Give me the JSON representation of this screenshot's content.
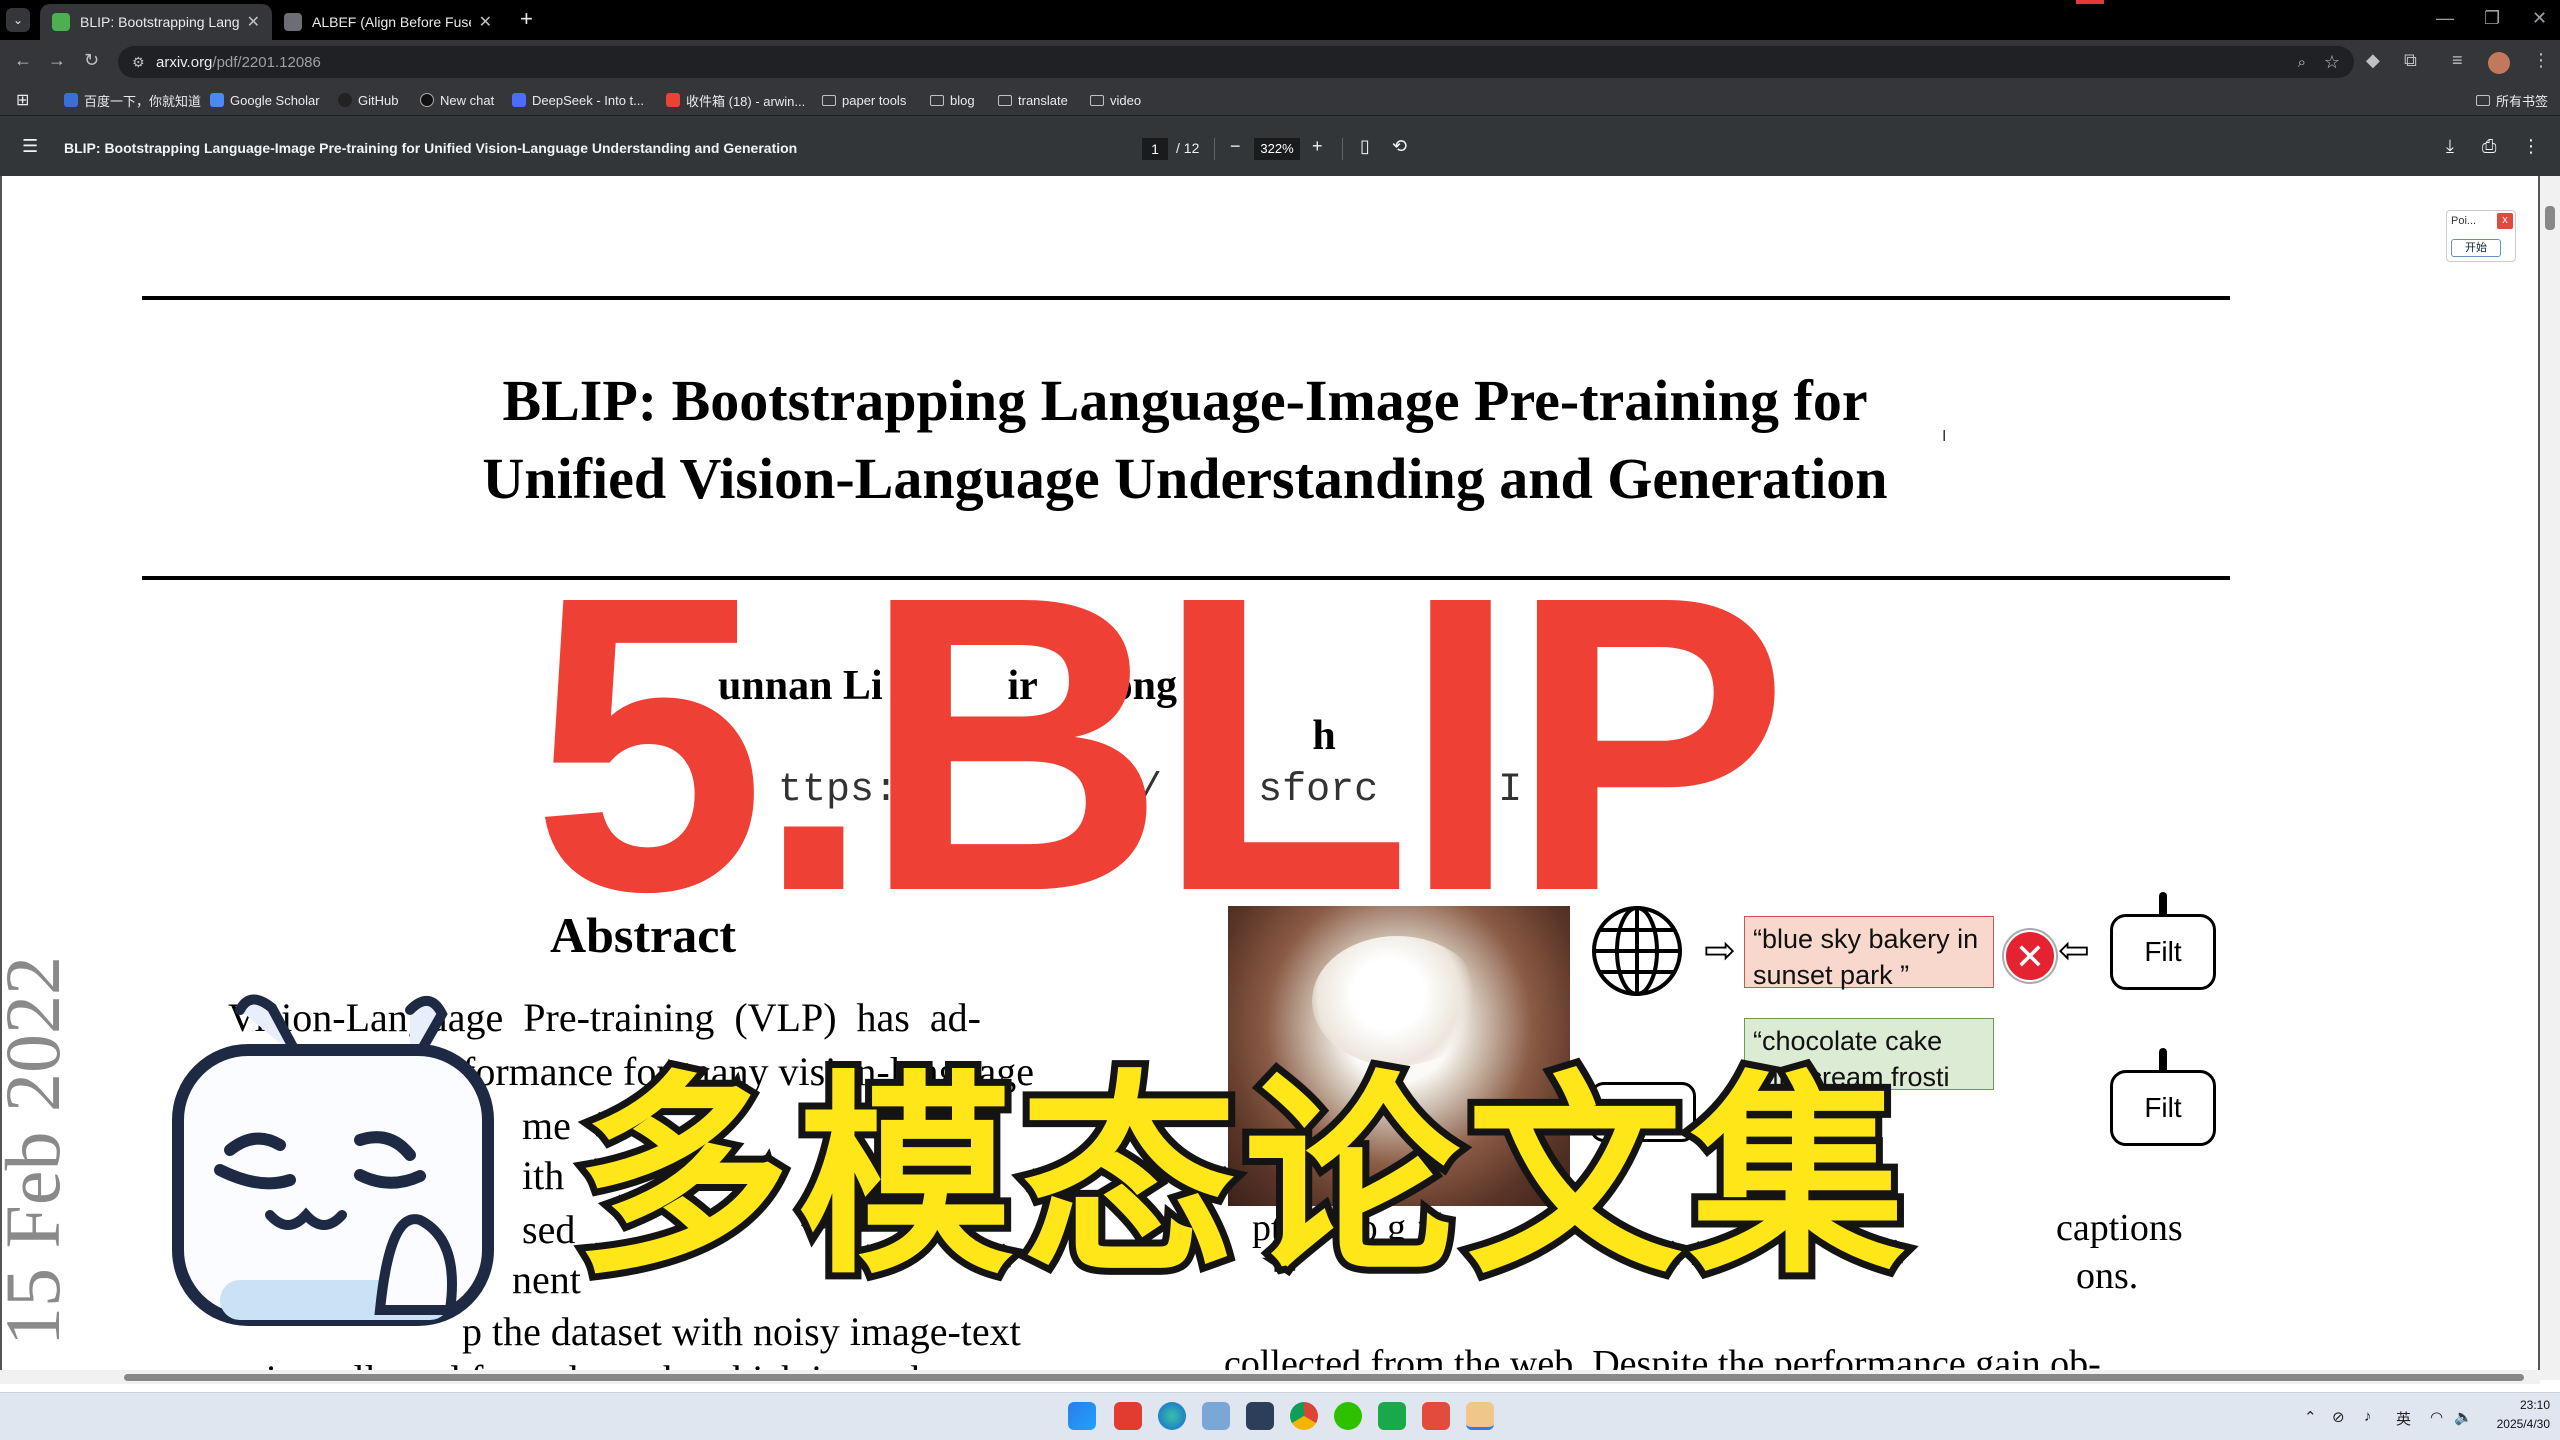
{
  "tabs": [
    {
      "title": "BLIP: Bootstrapping Languag",
      "close": "✕",
      "favicon_color": "#4caf50",
      "active": true
    },
    {
      "title": "ALBEF (Align Before Fuse)",
      "close": "✕",
      "favicon_color": "#9aa0a6",
      "active": false
    }
  ],
  "new_tab": "+",
  "window_controls": {
    "minimize": "—",
    "restore": "❐",
    "close": "✕"
  },
  "address_bar": {
    "url_host": "arxiv.org",
    "url_path": "/pdf/2201.12086"
  },
  "bookmarks": [
    {
      "label": "百度一下，你就知道",
      "icon": "baidu-icon"
    },
    {
      "label": "Google Scholar",
      "icon": "scholar-icon"
    },
    {
      "label": "GitHub",
      "icon": "github-icon"
    },
    {
      "label": "New chat",
      "icon": "chat-icon"
    },
    {
      "label": "DeepSeek - Into t...",
      "icon": "deepseek-icon"
    },
    {
      "label": "收件箱 (18) - arwin...",
      "icon": "gmail-icon"
    },
    {
      "label": "paper tools",
      "icon": "folder-icon"
    },
    {
      "label": "blog",
      "icon": "folder-icon"
    },
    {
      "label": "translate",
      "icon": "folder-icon"
    },
    {
      "label": "video",
      "icon": "folder-icon"
    }
  ],
  "all_bookmarks": "所有书签",
  "pdf_toolbar": {
    "title": "BLIP: Bootstrapping Language-Image Pre-training for Unified Vision-Language Understanding and Generation",
    "page_current": "1",
    "page_total": "/ 12",
    "zoom": "322%"
  },
  "paper": {
    "title_line1": "BLIP: Bootstrapping Language-Image Pre-training for",
    "title_line2": "Unified Vision-Language Understanding and Generation",
    "authors_line1": "unnan Li  D       ir      iong   S",
    "authors_line2": "R        h",
    "url_fragment": "ttps://        /    sforc     I",
    "abstract_heading": "Abstract",
    "abstract_lines": [
      "Vision-Language  Pre-training  (VLP)  has  ad-",
      "formance for many vision-language",
      "me",
      "ith",
      "sed",
      "nent",
      "p the dataset with noisy image-text",
      "pairs collected from the web, which is a subop-"
    ],
    "right_col_line1": "captions",
    "right_col_line2": "ons.",
    "right_col_line3": "collected from the web. Despite the performance gain ob-",
    "right_col_fragment": "ptio     o g",
    "arxiv_stamp": "15 Feb 2022"
  },
  "figure": {
    "caption_noisy": "“blue sky bakery in sunset park ”",
    "caption_clean": "“chocolate cake with cream frosti",
    "filter_label_1": "Filt",
    "filter_label_2": "Filt"
  },
  "overlay": {
    "big_title": "5.BLIP",
    "big_subtitle": "多模态论文集",
    "title_color": "#ee4035",
    "subtitle_color": "#ffe619"
  },
  "ext_popup": {
    "title": "Poi...",
    "close": "x",
    "button": "开始"
  },
  "clock": {
    "time": "23:10",
    "date": "2025/4/30"
  },
  "tray": {
    "lang": "英"
  },
  "taskbar_apps": [
    "windows-start-icon",
    "wps-icon",
    "edge-icon",
    "app-icon",
    "cat-icon",
    "chrome-icon",
    "wechat-icon",
    "green-app-icon",
    "red-app-icon",
    "paint-icon"
  ]
}
